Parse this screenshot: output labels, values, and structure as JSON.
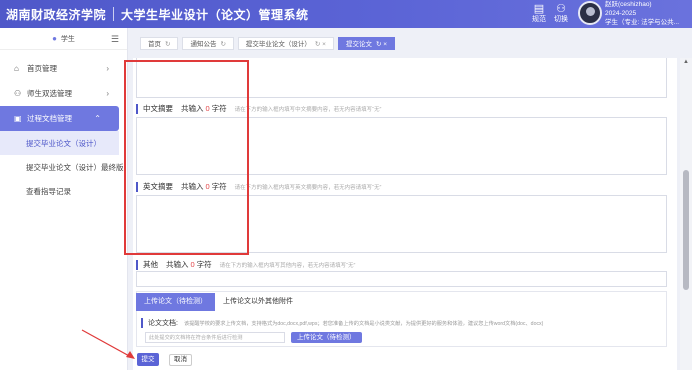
{
  "header": {
    "school": "湖南财政经济学院",
    "system": "大学生毕业设计（论文）管理系统",
    "rules_label": "规范",
    "switch_label": "切换",
    "user_name": "赵跃(ceshizhao)",
    "user_year": "2024-2025",
    "user_role": "学生（专业: 法学与公共..."
  },
  "sidebar": {
    "role": "学生",
    "items": [
      {
        "label": "首页管理"
      },
      {
        "label": "师生双选管理"
      },
      {
        "label": "过程文档管理"
      }
    ],
    "subitems": [
      {
        "label": "提交毕业论文（设计）"
      },
      {
        "label": "提交毕业论文（设计）最终版"
      },
      {
        "label": "查看指导记录"
      }
    ]
  },
  "tabs": [
    {
      "label": "首页"
    },
    {
      "label": "通知公告"
    },
    {
      "label": "提交毕业论文（设计）"
    },
    {
      "label": "提交论文"
    }
  ],
  "sections": {
    "cn_abstract": {
      "title": "中文摘要",
      "count_prefix": "共输入",
      "count": "0",
      "count_suffix": "字符",
      "hint": "请在下方的输入框内填写中文摘要内容，若无内容请填写“无”"
    },
    "en_abstract": {
      "title": "英文摘要",
      "count_prefix": "共输入",
      "count": "0",
      "count_suffix": "字符",
      "hint": "请在下方的输入框内填写英文摘要内容，若无内容请填写“无”"
    },
    "other": {
      "title": "其他",
      "count_prefix": "共输入",
      "count": "0",
      "count_suffix": "字符",
      "hint": "请在下方的输入框内填写其他内容，若无内容请填写“无”"
    }
  },
  "upload": {
    "tab_active": "上传论文（待检测）",
    "tab_other": "上传论文以外其他附件",
    "doc_label": "论文文档:",
    "doc_tip": "该提醒学校的要求上传文档，支持格式为doc,docx,pdf,wps；若您准备上传的文档是小说类文献，为提供更好的服务和体验，建议您上传word文档(doc、docx)",
    "file_placeholder": "此处提交的文档将在符合条件后进行检测",
    "upload_button": "上传论文（待检测）"
  },
  "actions": {
    "submit": "提交",
    "cancel": "取消"
  },
  "colors": {
    "brand": "#5b64d6",
    "annotation": "#e03a3a"
  }
}
